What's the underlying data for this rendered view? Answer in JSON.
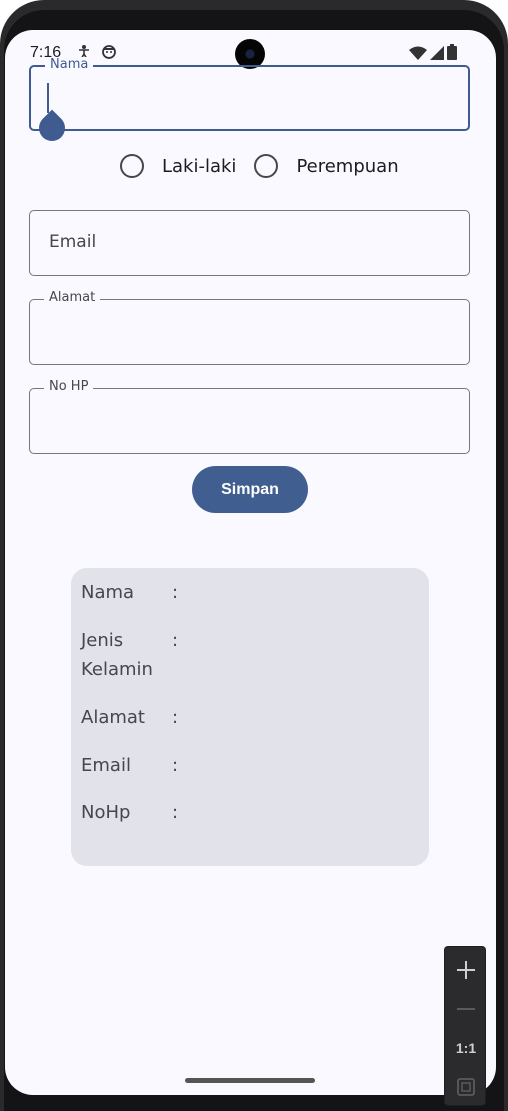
{
  "status_bar": {
    "time": "7:16"
  },
  "form": {
    "name_field": {
      "label": "Nama",
      "value": ""
    },
    "gender": {
      "options": [
        "Laki-laki",
        "Perempuan"
      ],
      "selected": null
    },
    "email_field": {
      "placeholder": "Email",
      "value": ""
    },
    "address_field": {
      "label": "Alamat",
      "value": ""
    },
    "phone_field": {
      "label": "No HP",
      "value": ""
    },
    "save_button": {
      "label": "Simpan"
    }
  },
  "result_card": {
    "rows": [
      {
        "label": "Nama",
        "sep": ":",
        "value": ""
      },
      {
        "label": "Jenis Kelamin",
        "sep": ":",
        "value": ""
      },
      {
        "label": "Alamat",
        "sep": ":",
        "value": ""
      },
      {
        "label": "Email",
        "sep": ":",
        "value": ""
      },
      {
        "label": "NoHp",
        "sep": ":",
        "value": ""
      }
    ]
  },
  "zoom_panel": {
    "one_to_one_label": "1:1"
  },
  "colors": {
    "primary": "#415e91",
    "background": "#f9f9ff",
    "card": "#e1e2ea",
    "outline": "#74777f"
  }
}
